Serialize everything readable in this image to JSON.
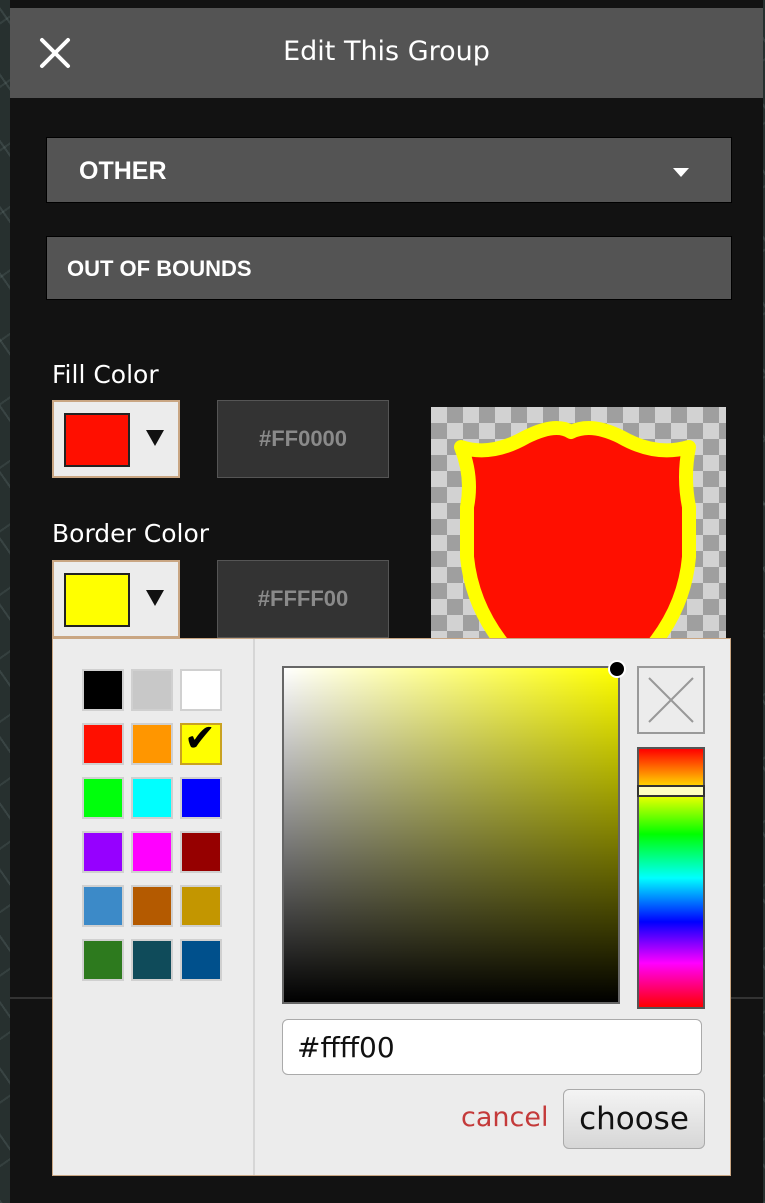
{
  "header": {
    "title": "Edit This Group",
    "close_icon": "close-icon"
  },
  "category": {
    "selected": "OTHER"
  },
  "group_name": {
    "value": "OUT OF BOUNDS"
  },
  "fill": {
    "label": "Fill Color",
    "hex": "#FF0000",
    "color": "#ff0f00"
  },
  "border": {
    "label": "Border Color",
    "hex": "#FFFF00",
    "color": "#ffff00"
  },
  "preview": {
    "fill": "#ff0f00",
    "stroke": "#ffff00"
  },
  "picker": {
    "palette": [
      [
        "#000000",
        "#c8c8c8",
        "#ffffff"
      ],
      [
        "#ff0f00",
        "#ff9600",
        "#ffff00"
      ],
      [
        "#00ff0c",
        "#00ffff",
        "#0000ff"
      ],
      [
        "#9600ff",
        "#ff00ff",
        "#960000"
      ],
      [
        "#3c8ac8",
        "#b45a00",
        "#c39600"
      ],
      [
        "#2d7a1e",
        "#0f4b5a",
        "#00508c"
      ]
    ],
    "selected_color": "#ffff00",
    "value": "#ffff00",
    "cancel_label": "cancel",
    "choose_label": "choose"
  }
}
